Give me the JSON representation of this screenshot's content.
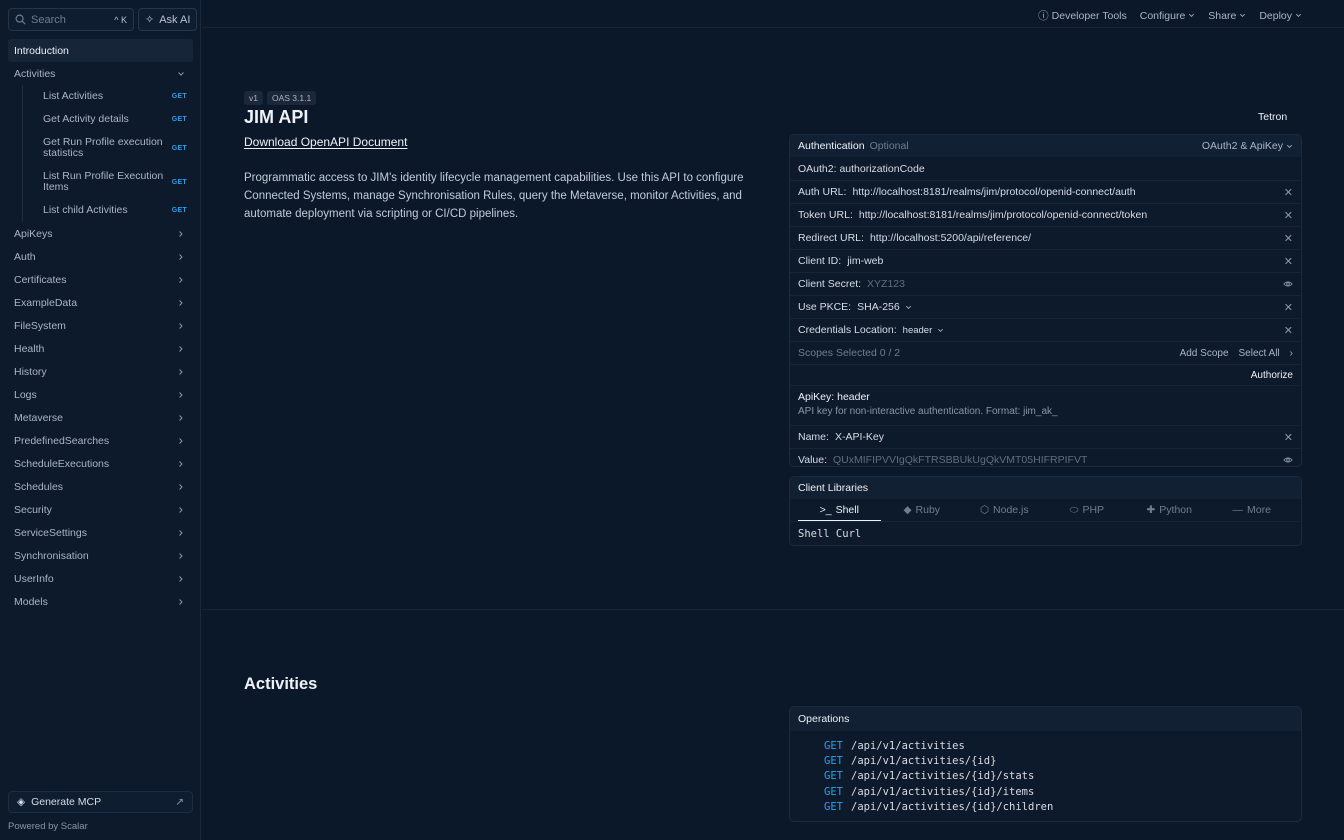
{
  "sidebar": {
    "search_placeholder": "Search",
    "search_shortcut": "^ K",
    "ask_ai": "Ask AI",
    "items": [
      {
        "label": "Introduction"
      },
      {
        "label": "Activities"
      },
      {
        "label": "ApiKeys"
      },
      {
        "label": "Auth"
      },
      {
        "label": "Certificates"
      },
      {
        "label": "ExampleData"
      },
      {
        "label": "FileSystem"
      },
      {
        "label": "Health"
      },
      {
        "label": "History"
      },
      {
        "label": "Logs"
      },
      {
        "label": "Metaverse"
      },
      {
        "label": "PredefinedSearches"
      },
      {
        "label": "ScheduleExecutions"
      },
      {
        "label": "Schedules"
      },
      {
        "label": "Security"
      },
      {
        "label": "ServiceSettings"
      },
      {
        "label": "Synchronisation"
      },
      {
        "label": "UserInfo"
      },
      {
        "label": "Models"
      }
    ],
    "activities_children": [
      {
        "label": "List Activities",
        "method": "GET"
      },
      {
        "label": "Get Activity details",
        "method": "GET"
      },
      {
        "label": "Get Run Profile execution statistics",
        "method": "GET"
      },
      {
        "label": "List Run Profile Execution Items",
        "method": "GET"
      },
      {
        "label": "List child Activities",
        "method": "GET"
      }
    ],
    "generate_mcp": "Generate MCP",
    "powered_by": "Powered by Scalar"
  },
  "topbar": {
    "developer_tools": "Developer Tools",
    "configure": "Configure",
    "share": "Share",
    "deploy": "Deploy"
  },
  "intro": {
    "version_badge": "v1",
    "oas_badge": "OAS 3.1.1",
    "title": "JIM API",
    "download_link": "Download OpenAPI Document",
    "description": "Programmatic access to JIM's identity lifecycle management capabilities. Use this API to configure Connected Systems, manage Synchronisation Rules, query the Metaverse, monitor Activities, and automate deployment via scripting or CI/CD pipelines."
  },
  "server": {
    "name": "Tetron"
  },
  "auth": {
    "title": "Authentication",
    "optional": "Optional",
    "selected_scheme": "OAuth2 & ApiKey",
    "oauth_title": "OAuth2: authorizationCode",
    "auth_url_label": "Auth URL:",
    "auth_url": "http://localhost:8181/realms/jim/protocol/openid-connect/auth",
    "token_url_label": "Token URL:",
    "token_url": "http://localhost:8181/realms/jim/protocol/openid-connect/token",
    "redirect_url_label": "Redirect URL:",
    "redirect_url": "http://localhost:5200/api/reference/",
    "client_id_label": "Client ID:",
    "client_id": "jim-web",
    "client_secret_label": "Client Secret:",
    "client_secret_placeholder": "XYZ123",
    "pkce_label": "Use PKCE:",
    "pkce_value": "SHA-256",
    "credentials_location_label": "Credentials Location:",
    "credentials_location": "header",
    "scopes_selected": "Scopes Selected 0 / 2",
    "add_scope": "Add Scope",
    "select_all": "Select All",
    "authorize": "Authorize",
    "apikey_title": "ApiKey: header",
    "apikey_desc": "API key for non-interactive authentication. Format: jim_ak_",
    "name_label": "Name:",
    "name_value": "X-API-Key",
    "value_label": "Value:",
    "value_placeholder": "QUxMIFIPVVIgQkFTRSBBUkUgQkVMT05HIFRPIFVT"
  },
  "client_libraries": {
    "title": "Client Libraries",
    "tabs": [
      "Shell",
      "Ruby",
      "Node.js",
      "PHP",
      "Python",
      "More"
    ],
    "active_tab": "Shell",
    "variant": "Shell Curl"
  },
  "activities_section": {
    "title": "Activities",
    "operations_title": "Operations",
    "operations": [
      {
        "method": "GET",
        "path": "/api/v1/activities"
      },
      {
        "method": "GET",
        "path": "/api/v1/activities/{id}"
      },
      {
        "method": "GET",
        "path": "/api/v1/activities/{id}/stats"
      },
      {
        "method": "GET",
        "path": "/api/v1/activities/{id}/items"
      },
      {
        "method": "GET",
        "path": "/api/v1/activities/{id}/children"
      }
    ]
  },
  "colors": {
    "background": "#0b1829",
    "sidebar": "#0d1a2c",
    "accent_get": "#2e9fe6",
    "text": "#d7dde6"
  }
}
